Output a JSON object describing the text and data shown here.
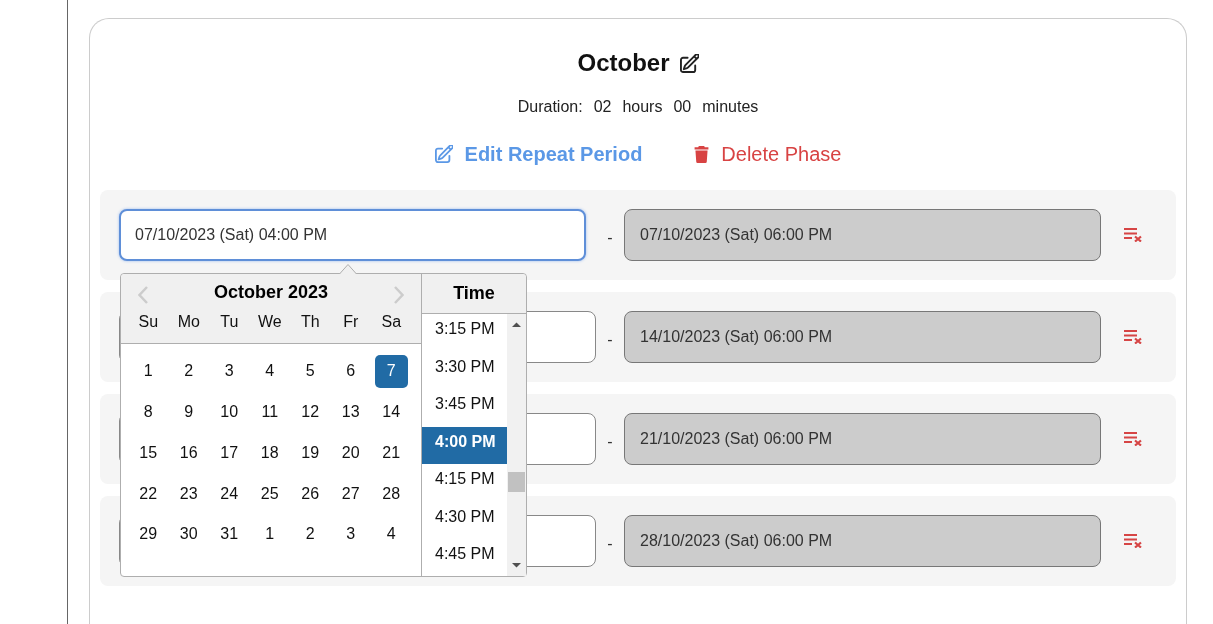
{
  "phase": {
    "title": "October",
    "duration": {
      "label": "Duration:",
      "hours": "02",
      "hours_unit": "hours",
      "minutes": "00",
      "minutes_unit": "minutes"
    },
    "actions": [
      {
        "kind": "edit",
        "label": "Edit Repeat Period"
      },
      {
        "kind": "delete",
        "label": "Delete Phase"
      }
    ],
    "periods": [
      {
        "start": {
          "value": "07/10/2023 (Sat) 04:00 PM",
          "focused": true
        },
        "separator": "-",
        "end": {
          "value": "07/10/2023 (Sat) 06:00 PM",
          "disabled": true
        }
      },
      {
        "start": {
          "focused": false
        },
        "separator": "-",
        "end": {
          "value": "14/10/2023 (Sat) 06:00 PM",
          "disabled": true
        }
      },
      {
        "start": {
          "focused": false
        },
        "separator": "-",
        "end": {
          "value": "21/10/2023 (Sat) 06:00 PM",
          "disabled": true
        }
      },
      {
        "start": {
          "focused": false
        },
        "separator": "-",
        "end": {
          "value": "28/10/2023 (Sat) 06:00 PM",
          "disabled": true
        }
      }
    ]
  },
  "date_picker": {
    "month": "October 2023",
    "weekdays": [
      "Su",
      "Mo",
      "Tu",
      "We",
      "Th",
      "Fr",
      "Sa"
    ],
    "weeks": [
      [
        {
          "label": "1",
          "selected": false
        },
        {
          "label": "2",
          "selected": false
        },
        {
          "label": "3",
          "selected": false
        },
        {
          "label": "4",
          "selected": false
        },
        {
          "label": "5",
          "selected": false
        },
        {
          "label": "6",
          "selected": false
        },
        {
          "label": "7",
          "selected": true
        }
      ],
      [
        {
          "label": "8",
          "selected": false
        },
        {
          "label": "9",
          "selected": false
        },
        {
          "label": "10",
          "selected": false
        },
        {
          "label": "11",
          "selected": false
        },
        {
          "label": "12",
          "selected": false
        },
        {
          "label": "13",
          "selected": false
        },
        {
          "label": "14",
          "selected": false
        }
      ],
      [
        {
          "label": "15",
          "selected": false
        },
        {
          "label": "16",
          "selected": false
        },
        {
          "label": "17",
          "selected": false
        },
        {
          "label": "18",
          "selected": false
        },
        {
          "label": "19",
          "selected": false
        },
        {
          "label": "20",
          "selected": false
        },
        {
          "label": "21",
          "selected": false
        }
      ],
      [
        {
          "label": "22",
          "selected": false
        },
        {
          "label": "23",
          "selected": false
        },
        {
          "label": "24",
          "selected": false
        },
        {
          "label": "25",
          "selected": false
        },
        {
          "label": "26",
          "selected": false
        },
        {
          "label": "27",
          "selected": false
        },
        {
          "label": "28",
          "selected": false
        }
      ],
      [
        {
          "label": "29",
          "selected": false
        },
        {
          "label": "30",
          "selected": false
        },
        {
          "label": "31",
          "selected": false
        },
        {
          "label": "1",
          "selected": false
        },
        {
          "label": "2",
          "selected": false
        },
        {
          "label": "3",
          "selected": false
        },
        {
          "label": "4",
          "selected": false
        }
      ]
    ],
    "time_header": "Time",
    "times": [
      {
        "label": "3:15 PM",
        "selected": false
      },
      {
        "label": "3:30 PM",
        "selected": false
      },
      {
        "label": "3:45 PM",
        "selected": false
      },
      {
        "label": "4:00 PM",
        "selected": true
      },
      {
        "label": "4:15 PM",
        "selected": false
      },
      {
        "label": "4:30 PM",
        "selected": false
      },
      {
        "label": "4:45 PM",
        "selected": false
      }
    ]
  }
}
